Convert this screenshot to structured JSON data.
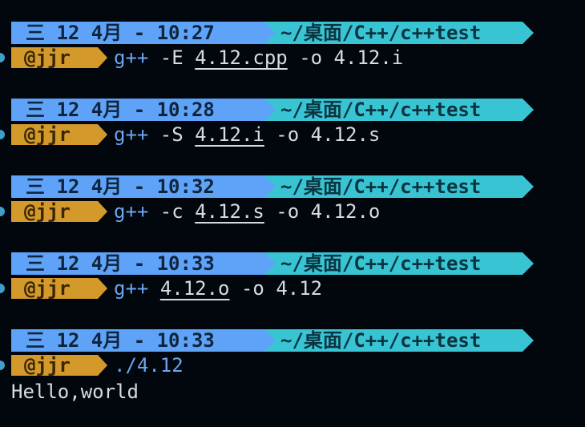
{
  "prompts": [
    {
      "date": "三 12 4月 - 10:27",
      "path": "~/桌面/C++/c++test",
      "user": "@jjr",
      "program": "g++",
      "before": " -E ",
      "file": "4.12.cpp",
      "after": " -o 4.12.i"
    },
    {
      "date": "三 12 4月 - 10:28",
      "path": "~/桌面/C++/c++test",
      "user": "@jjr",
      "program": "g++",
      "before": " -S ",
      "file": "4.12.i",
      "after": " -o 4.12.s"
    },
    {
      "date": "三 12 4月 - 10:32",
      "path": "~/桌面/C++/c++test",
      "user": "@jjr",
      "program": "g++",
      "before": " -c ",
      "file": "4.12.s",
      "after": " -o 4.12.o"
    },
    {
      "date": "三 12 4月 - 10:33",
      "path": "~/桌面/C++/c++test",
      "user": "@jjr",
      "program": "g++",
      "before": " ",
      "file": "4.12.o",
      "after": " -o 4.12"
    },
    {
      "date": "三 12 4月 - 10:33",
      "path": "~/桌面/C++/c++test",
      "user": "@jjr",
      "program": "./4.12",
      "before": "",
      "file": "",
      "after": ""
    }
  ],
  "output": "Hello,world",
  "colors": {
    "background": "#02060d",
    "date_segment": "#5ea3f7",
    "path_segment": "#38c4d3",
    "user_segment": "#d39a2b",
    "command_program": "#6aa6f0",
    "text": "#d6dbe4"
  }
}
